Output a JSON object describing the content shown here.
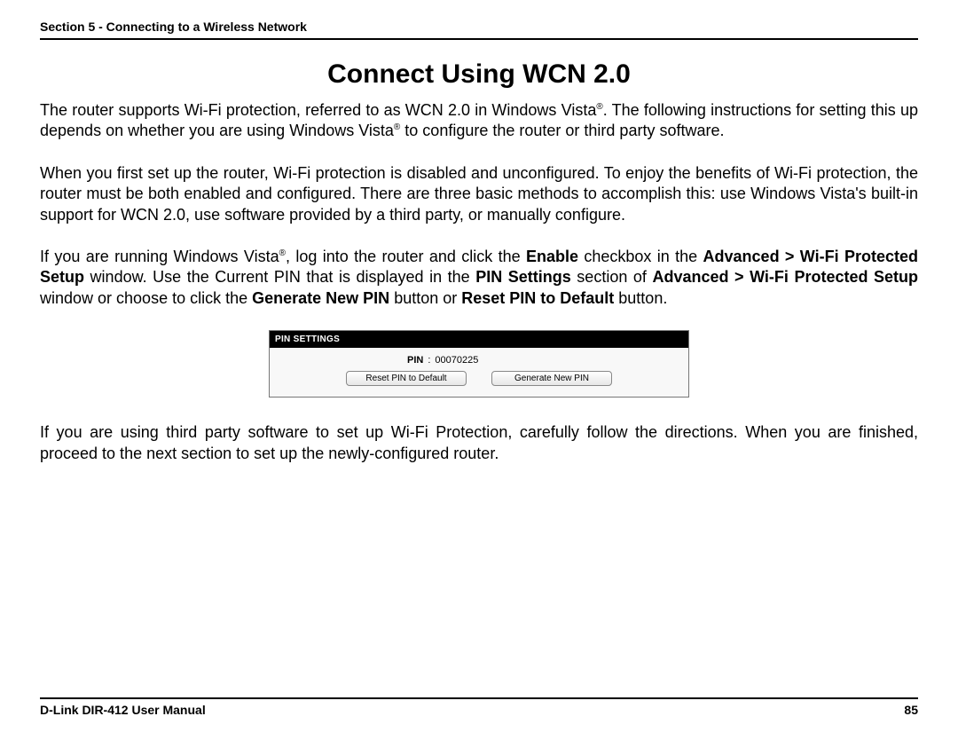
{
  "header": {
    "section_label": "Section 5 - Connecting to a Wireless Network"
  },
  "title": "Connect Using WCN 2.0",
  "paragraphs": {
    "p1_a": "The router supports Wi-Fi protection, referred to as WCN 2.0 in Windows Vista",
    "p1_b": ". The following instructions for setting this up depends on whether you are using Windows Vista",
    "p1_c": " to configure the router or third party software.",
    "p2": "When you first set up the router, Wi-Fi protection is disabled and unconfigured. To enjoy the benefits of Wi-Fi protection, the router must be both enabled and configured. There are three basic methods to accomplish this: use Windows Vista's built-in support for WCN 2.0, use software provided by a third party, or manually configure.",
    "p3_a": "If you are running Windows Vista",
    "p3_b": ", log into the router and click the ",
    "p3_c": " checkbox in the ",
    "p3_d": " window. Use the Current PIN that is displayed in the ",
    "p3_e": " section of ",
    "p3_f": " window or choose to click the ",
    "p3_g": " button or ",
    "p3_h": " button.",
    "p4": "If you are using third party software to set up Wi-Fi Protection, carefully follow the directions. When you are finished, proceed to the next section to set up the newly-configured router."
  },
  "bold": {
    "enable": "Enable",
    "advanced_wps": "Advanced > Wi-Fi Protected Setup",
    "pin_settings": "PIN Settings",
    "generate_new_pin": "Generate New PIN",
    "reset_pin": "Reset PIN to Default"
  },
  "reg_mark": "®",
  "pin_panel": {
    "header": "PIN SETTINGS",
    "label": "PIN",
    "colon": ":",
    "value": "00070225",
    "btn_reset": "Reset PIN to Default",
    "btn_generate": "Generate New PIN"
  },
  "footer": {
    "left": "D-Link DIR-412 User Manual",
    "right": "85"
  }
}
